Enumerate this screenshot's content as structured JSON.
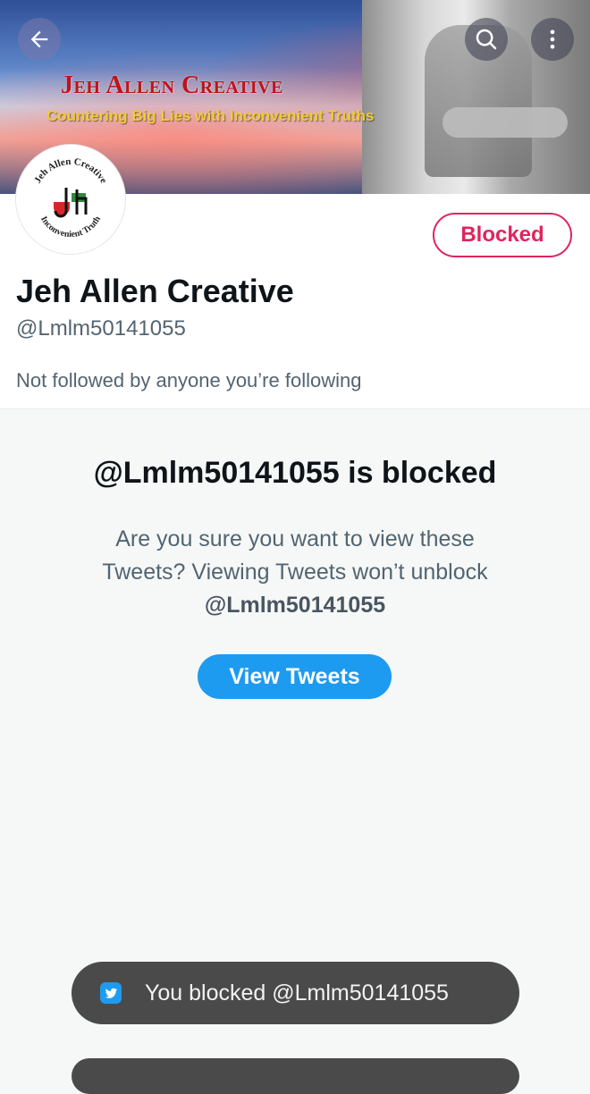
{
  "banner": {
    "title": "Jeh Allen Creative",
    "tagline": "Countering Big Lies with Inconvenient Truths"
  },
  "avatar": {
    "ring_top": "Jeh Allen Creative",
    "ring_bottom": "Inconvenient Truth",
    "colors": {
      "red": "#d7262b",
      "green": "#2f8c3f",
      "black": "#111111"
    }
  },
  "nav": {
    "back_icon": "arrow-left-icon",
    "search_icon": "search-icon",
    "more_icon": "more-vertical-icon"
  },
  "profile": {
    "name": "Jeh Allen Creative",
    "handle": "@Lmlm50141055",
    "follow_context": "Not followed by anyone you’re following",
    "blocked_button_label": "Blocked"
  },
  "blocked_notice": {
    "title": "@Lmlm50141055 is blocked",
    "message": "Are you sure you want to view these Tweets? Viewing Tweets won’t unblock",
    "message_handle": "@Lmlm50141055",
    "view_button_label": "View Tweets"
  },
  "toast": {
    "icon": "twitter-bird-icon",
    "text": "You blocked @Lmlm50141055"
  },
  "colors": {
    "accent": "#1d9bf0",
    "blocked": "#e0245e",
    "text_primary": "#0f1419",
    "text_secondary": "#536471"
  }
}
